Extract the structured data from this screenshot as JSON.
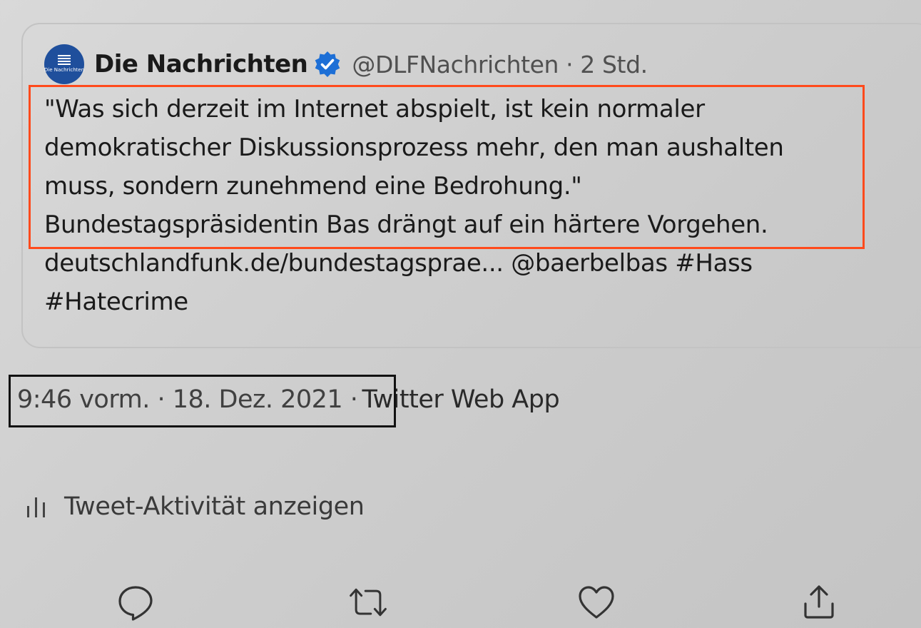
{
  "quoted_tweet": {
    "author_name": "Die Nachrichten",
    "handle_and_time": "@DLFNachrichten · 2 Std.",
    "avatar_icon": "deutschlandfunk-logo",
    "avatar_text": "Die Nachrichten",
    "lines": [
      "\"Was sich derzeit im Internet abspielt, ist kein normaler",
      "demokratischer Diskussionsprozess mehr, den man aushalten",
      "muss, sondern zunehmend eine Bedrohung.\"",
      "Bundestagspräsidentin Bas drängt auf ein härtere Vorgehen.",
      "deutschlandfunk.de/bundestagsprae... @baerbelbas #Hass",
      "#Hatecrime"
    ]
  },
  "meta": {
    "timestamp": "9:46 vorm. · 18. Dez. 2021 ·",
    "source": "Twitter Web App"
  },
  "activity": {
    "label": "Tweet-Aktivität anzeigen",
    "icon": "bar-chart-icon"
  },
  "actions": [
    {
      "icon": "reply-icon"
    },
    {
      "icon": "retweet-icon"
    },
    {
      "icon": "like-icon"
    },
    {
      "icon": "share-icon"
    }
  ],
  "colors": {
    "highlight_box": "#ff4a1c",
    "timestamp_box": "#111111",
    "verified_badge": "#1d6fd6",
    "avatar": "#1f4f9c"
  }
}
